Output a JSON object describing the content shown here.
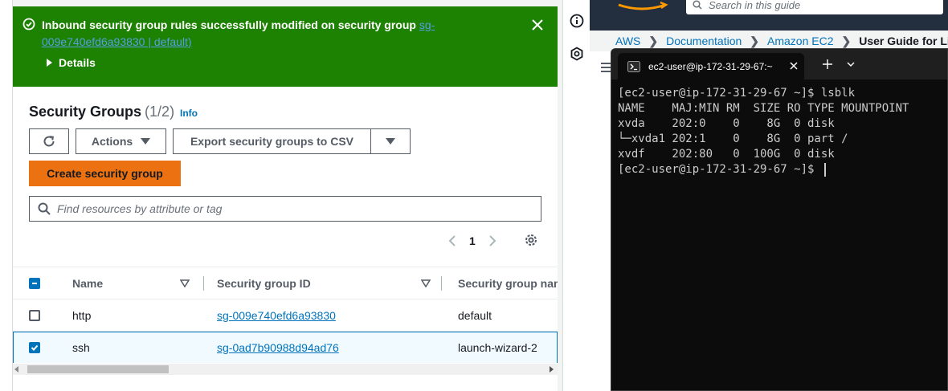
{
  "flash": {
    "message_prefix": "Inbound security group rules successfully modified on security group",
    "message_link": "sg-009e740efd6a93830 | default)",
    "details_label": "Details"
  },
  "security_groups": {
    "title": "Security Groups",
    "count": "(1/2)",
    "info_label": "Info",
    "actions_label": "Actions",
    "export_label": "Export security groups to CSV",
    "create_label": "Create security group",
    "search_placeholder": "Find resources by attribute or tag",
    "page": "1",
    "columns": [
      "Name",
      "Security group ID",
      "Security group nam"
    ],
    "rows": [
      {
        "name": "http",
        "id": "sg-009e740efd6a93830",
        "group_name": "default",
        "checked": false
      },
      {
        "name": "ssh",
        "id": "sg-0ad7b90988d94ad76",
        "group_name": "launch-wizard-2",
        "checked": true
      }
    ]
  },
  "docs": {
    "search_placeholder": "Search in this guide",
    "breadcrumbs": [
      "AWS",
      "Documentation",
      "Amazon EC2",
      "User Guide for Li"
    ]
  },
  "terminal": {
    "tab_title": "ec2-user@ip-172-31-29-67:~",
    "lines": [
      "[ec2-user@ip-172-31-29-67 ~]$ lsblk",
      "NAME    MAJ:MIN RM  SIZE RO TYPE MOUNTPOINT",
      "xvda    202:0    0    8G  0 disk",
      "└─xvda1 202:1    0    8G  0 part /",
      "xvdf    202:80   0  100G  0 disk",
      "[ec2-user@ip-172-31-29-67 ~]$ "
    ]
  },
  "colors": {
    "success": "#1d8102",
    "primary_button": "#ec7211",
    "link": "#0073bb",
    "terminal_bg": "#0c0c0c"
  }
}
